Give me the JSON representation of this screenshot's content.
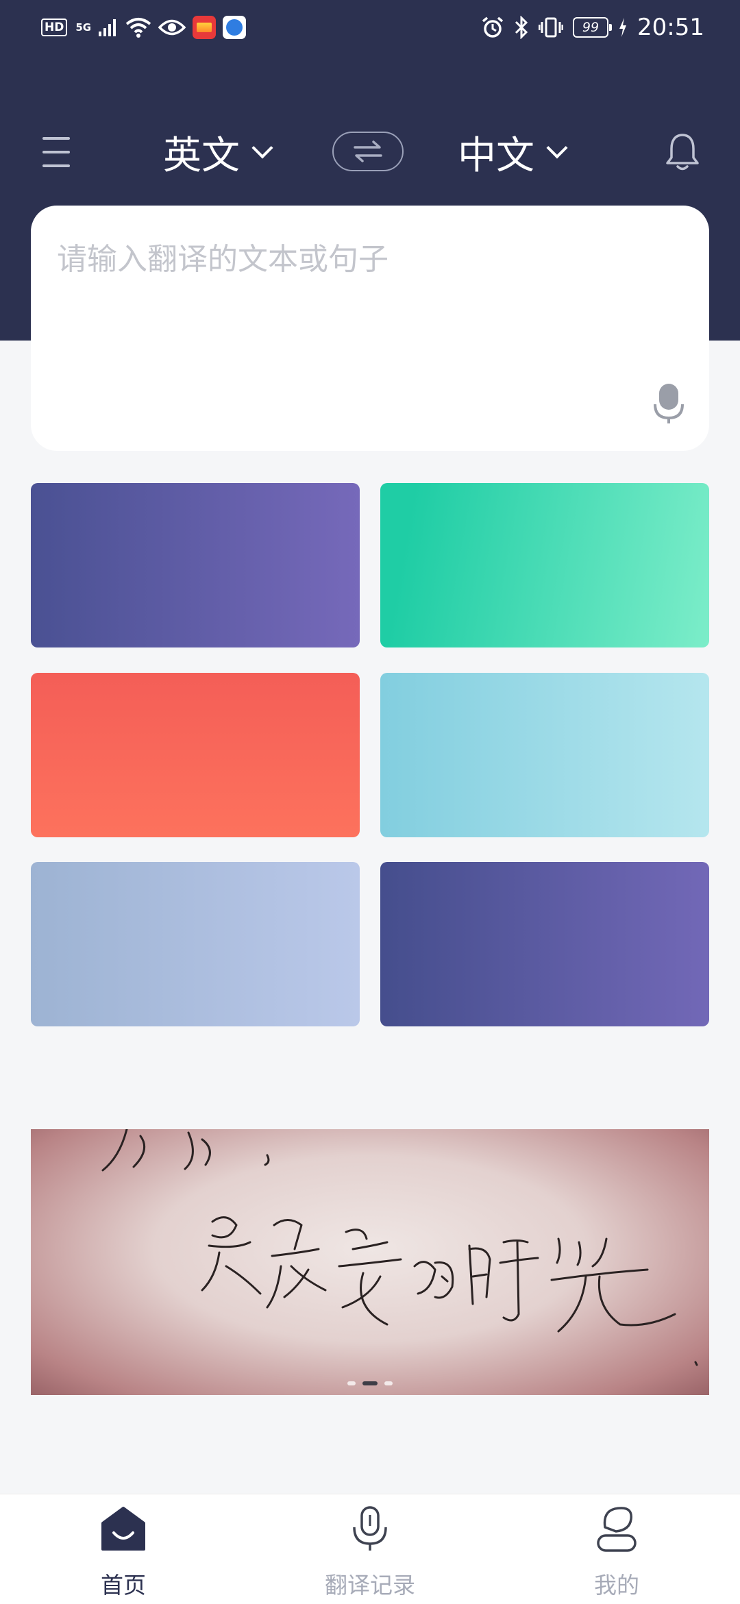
{
  "status_bar": {
    "hd_label": "HD",
    "network_label": "5G",
    "battery_level": "99",
    "time": "20:51"
  },
  "top_bar": {
    "source_language": "英文",
    "target_language": "中文",
    "icons": [
      "menu-icon",
      "swap-icon",
      "bell-icon",
      "chevron-down-icon"
    ]
  },
  "input": {
    "placeholder": "请输入翻译的文本或句子",
    "value": ""
  },
  "tiles": {
    "colors": [
      [
        "#4a5193",
        "#7669ba"
      ],
      [
        "#1fcda5",
        "#7cedc9"
      ],
      [
        "#f45e57",
        "#fd725d"
      ],
      [
        "#82cedf",
        "#b5e6ee"
      ],
      [
        "#9db3d3",
        "#bac8e9"
      ],
      [
        "#454e8d",
        "#7268b7"
      ]
    ]
  },
  "banner": {
    "slide_count": 3,
    "active_slide": 2
  },
  "bottom_nav": {
    "home_label": "首页",
    "history_label": "翻译记录",
    "mine_label": "我的",
    "active": "home"
  },
  "colors": {
    "header_bg": "#2c3150",
    "page_bg": "#f5f6f8",
    "nav_active": "#2c3150",
    "nav_inactive": "#a7abb8"
  }
}
